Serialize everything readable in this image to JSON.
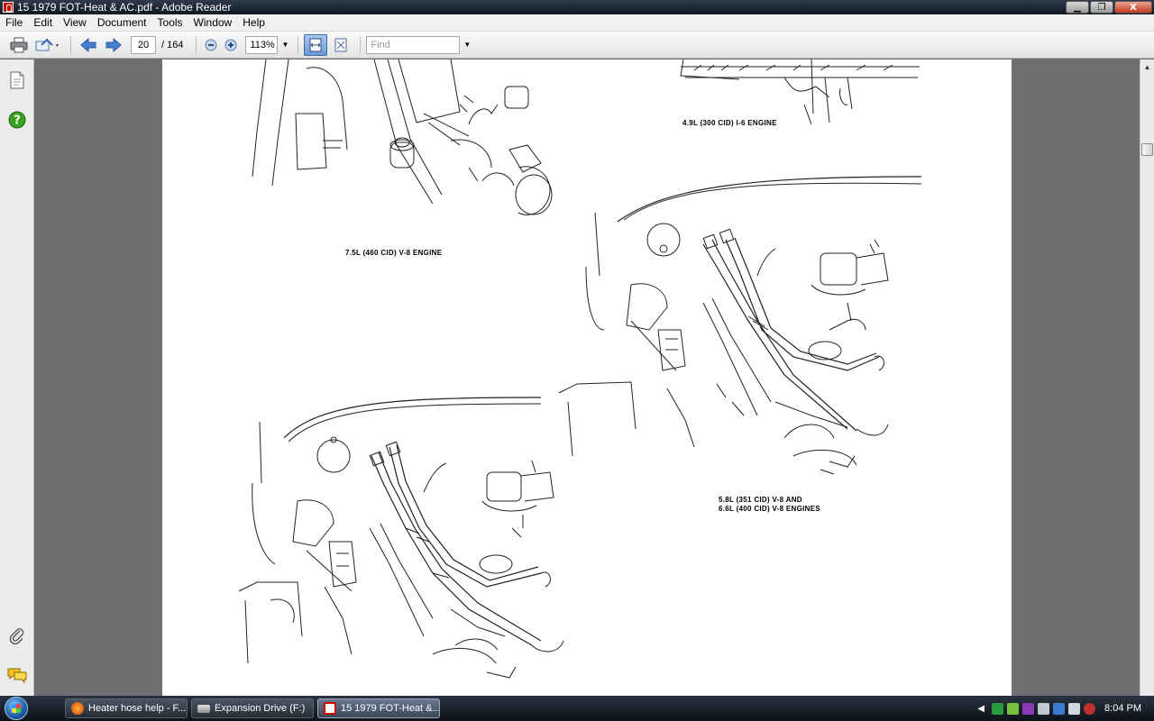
{
  "window": {
    "title": "15 1979 FOT-Heat & AC.pdf - Adobe Reader",
    "minimize_glyph": "▁",
    "restore_glyph": "❐",
    "close_glyph": "X"
  },
  "menu": {
    "items": [
      "File",
      "Edit",
      "View",
      "Document",
      "Tools",
      "Window",
      "Help"
    ]
  },
  "toolbar": {
    "page_current": "20",
    "page_total": "/ 164",
    "zoom": "113%",
    "find_placeholder": "Find"
  },
  "document": {
    "captions": {
      "i6": "4.9L (300 CID) I-6 ENGINE",
      "v8_460": "7.5L (460 CID) V-8 ENGINE",
      "v8_351_line1": "5.8L (351 CID) V-8 AND",
      "v8_351_line2": "6.6L (400 CID) V-8 ENGINES"
    }
  },
  "taskbar": {
    "items": [
      {
        "label": "Heater hose help - F...",
        "icon": "firefox-icon",
        "active": false
      },
      {
        "label": "Expansion Drive (F:)",
        "icon": "drive-icon",
        "active": false
      },
      {
        "label": "15 1979 FOT-Heat &...",
        "icon": "pdf-icon",
        "active": true
      }
    ],
    "clock": "8:04 PM"
  },
  "colors": {
    "accent": "#3c6cb0",
    "pdf_red": "#cc0000",
    "help_green": "#3aa020"
  }
}
